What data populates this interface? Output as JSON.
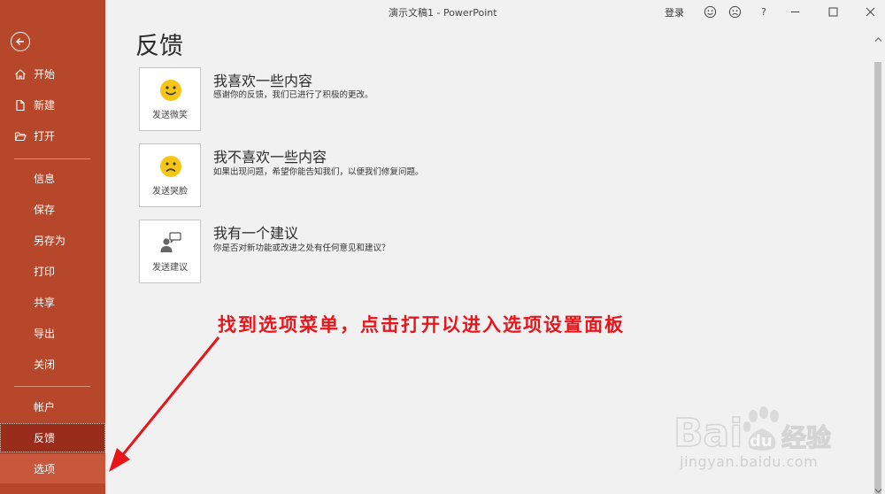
{
  "app": {
    "title": "演示文稿1 - PowerPoint",
    "login": "登录",
    "help": "?"
  },
  "sidebar": {
    "items_top": [
      {
        "label": "开始",
        "icon": "home-icon"
      },
      {
        "label": "新建",
        "icon": "new-document-icon"
      },
      {
        "label": "打开",
        "icon": "open-folder-icon"
      }
    ],
    "items_mid": [
      "信息",
      "保存",
      "另存为",
      "打印",
      "共享",
      "导出",
      "关闭"
    ],
    "items_bottom": [
      "帐户",
      "反馈",
      "选项"
    ],
    "selected": "反馈",
    "hovered": "选项"
  },
  "main": {
    "page_title": "反馈",
    "items": [
      {
        "card_label": "发送微笑",
        "title": "我喜欢一些内容",
        "desc": "感谢你的反馈，我们已进行了积极的更改。",
        "icon": "smile-face-icon"
      },
      {
        "card_label": "发送哭脸",
        "title": "我不喜欢一些内容",
        "desc": "如果出现问题，希望你能告知我们，以便我们修复问题。",
        "icon": "frown-face-icon"
      },
      {
        "card_label": "发送建议",
        "title": "我有一个建议",
        "desc": "你是否对新功能或改进之处有任何意见和建议？",
        "icon": "suggestion-person-icon"
      }
    ]
  },
  "annotation": {
    "text": "找到选项菜单，点击打开以进入选项设置面板",
    "color": "#e8151b"
  },
  "watermark": {
    "brand": "Baidu经验",
    "url": "jingyan.baidu.com"
  },
  "colors": {
    "sidebar": "#b7472a",
    "selected": "#992c1a",
    "smile": "#f5c518"
  }
}
